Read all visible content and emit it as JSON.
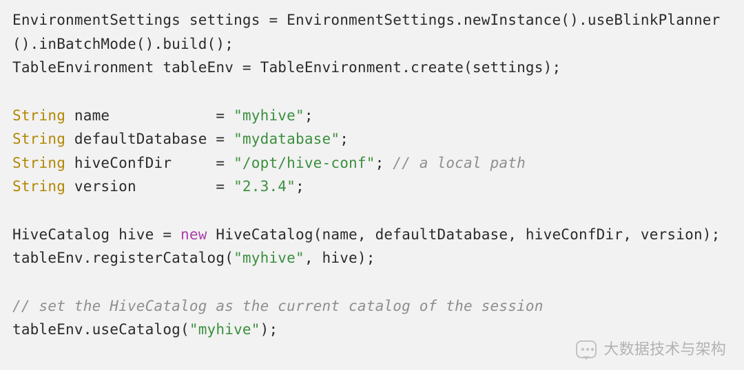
{
  "code": {
    "line1": {
      "type1": "EnvironmentSettings",
      "ident1": " settings = ",
      "type2": "EnvironmentSettings",
      "rest": ".newInstance().useBlinkPlanner().inBatchMode().build();"
    },
    "line2": {
      "type1": "TableEnvironment",
      "ident1": " tableEnv = ",
      "type2": "TableEnvironment",
      "rest": ".create(settings);"
    },
    "decl_type": "String",
    "decl1": {
      "name": " name            = ",
      "value": "\"myhive\"",
      "tail": ";"
    },
    "decl2": {
      "name": " defaultDatabase = ",
      "value": "\"mydatabase\"",
      "tail": ";"
    },
    "decl3": {
      "name": " hiveConfDir     = ",
      "value": "\"/opt/hive-conf\"",
      "tail": "; ",
      "comment": "// a local path"
    },
    "decl4": {
      "name": " version         = ",
      "value": "\"2.3.4\"",
      "tail": ";"
    },
    "line_hive": {
      "type": "HiveCatalog",
      "lhs": " hive = ",
      "new": "new",
      "ctor": " HiveCatalog",
      "args": "(name, defaultDatabase, hiveConfDir, version);"
    },
    "line_reg": {
      "pre": "tableEnv.registerCatalog(",
      "str": "\"myhive\"",
      "post": ", hive);"
    },
    "comment_session": "// set the HiveCatalog as the current catalog of the session",
    "line_use": {
      "pre": "tableEnv.useCatalog(",
      "str": "\"myhive\"",
      "post": ");"
    }
  },
  "watermark": {
    "text": "大数据技术与架构"
  }
}
